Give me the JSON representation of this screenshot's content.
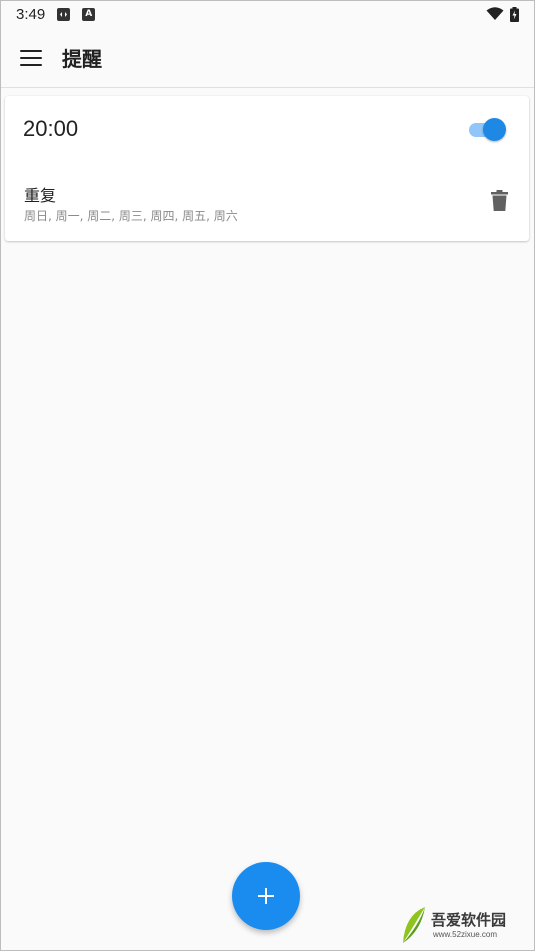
{
  "status_bar": {
    "time": "3:49",
    "icons": [
      "sim-icon",
      "a-icon",
      "wifi-icon",
      "battery-icon"
    ],
    "a_icon_label": "A"
  },
  "app_bar": {
    "title": "提醒",
    "menu_icon": "menu-icon"
  },
  "reminder": {
    "time": "20:00",
    "enabled": true,
    "repeat_label": "重复",
    "repeat_days": "周日, 周一, 周二, 周三, 周四, 周五, 周六",
    "delete_icon": "trash-icon"
  },
  "fab": {
    "icon": "plus-icon"
  },
  "watermark": {
    "name": "吾爱软件园",
    "url": "www.52zixue.com"
  },
  "colors": {
    "accent": "#1a8cf0",
    "toggle_track": "#90c6f9",
    "background": "#fafafa"
  }
}
